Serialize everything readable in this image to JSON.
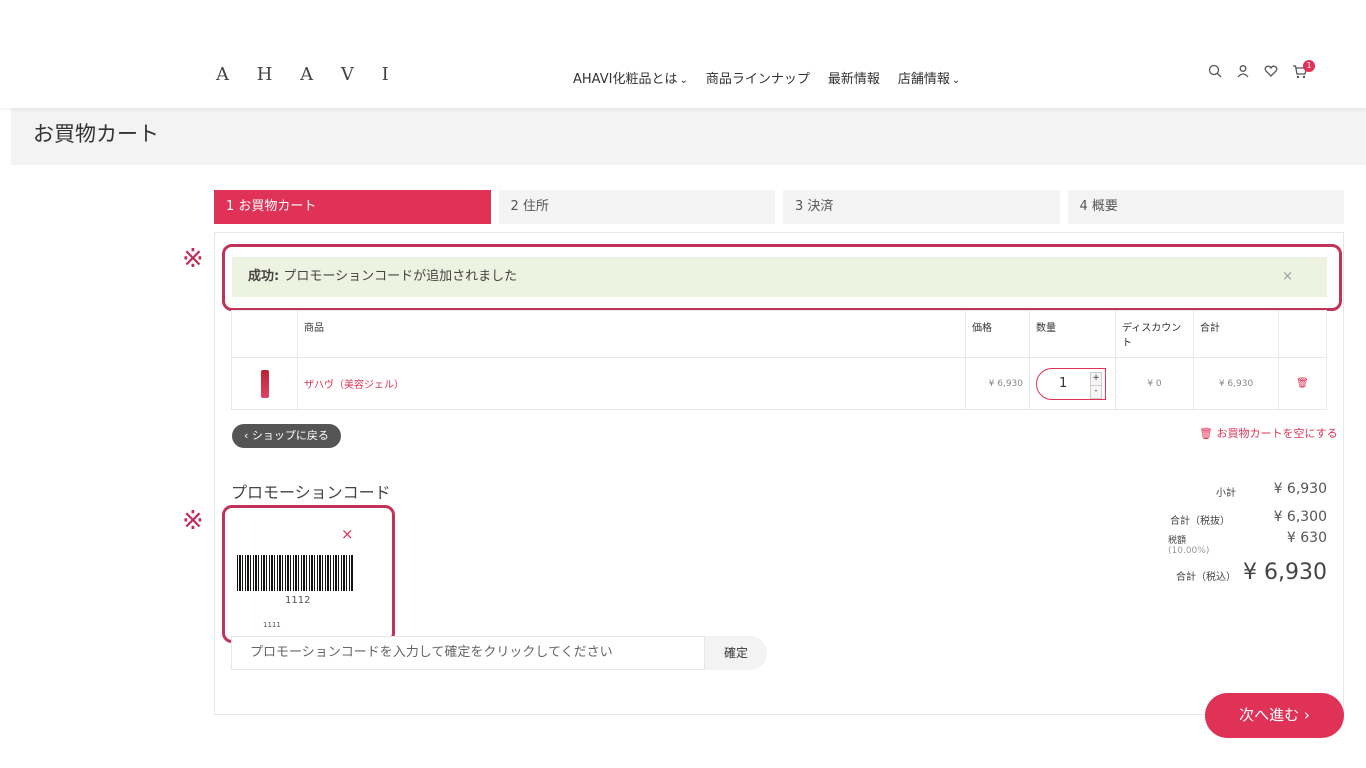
{
  "header": {
    "logo": "A H A V I",
    "nav": [
      {
        "label": "AHAVI化粧品とは",
        "has_dropdown": true
      },
      {
        "label": "商品ラインナップ",
        "has_dropdown": false
      },
      {
        "label": "最新情報",
        "has_dropdown": false
      },
      {
        "label": "店舗情報",
        "has_dropdown": true
      }
    ],
    "cart_count": "1",
    "icons": [
      "search-icon",
      "user-icon",
      "heart-icon",
      "cart-icon"
    ]
  },
  "page_title": "お買物カート",
  "steps": [
    {
      "label": "1  お買物カート",
      "active": true
    },
    {
      "label": "2  住所",
      "active": false
    },
    {
      "label": "3  決済",
      "active": false
    },
    {
      "label": "4  概要",
      "active": false
    }
  ],
  "annotation_mark": "※",
  "alert": {
    "strong": "成功:",
    "message": " プロモーションコードが追加されました",
    "close": "×"
  },
  "table": {
    "headers": [
      "",
      "商品",
      "価格",
      "数量",
      "ディスカウント",
      "合計",
      ""
    ],
    "rows": [
      {
        "product": "ザハヴ（美容ジェル）",
        "price": "¥ 6,930",
        "qty": "1",
        "discount": "¥ 0",
        "total": "¥ 6,930"
      }
    ]
  },
  "back_button": "ショップに戻る",
  "empty_cart": "お買物カートを空にする",
  "promo": {
    "title": "プロモーションコード",
    "coupon_barcode_number": "1112",
    "coupon_code": "1111",
    "remove": "×",
    "placeholder": "プロモーションコードを入力して確定をクリックしてください",
    "confirm": "確定"
  },
  "totals": {
    "subtotal_label": "小計",
    "subtotal": "¥ 6,930",
    "net_label": "合計（税抜）",
    "net": "¥ 6,300",
    "tax_label": "税額",
    "tax_rate": "(10.00%)",
    "tax": "¥ 630",
    "gross_label": "合計（税込）",
    "gross": "¥ 6,930"
  },
  "next_button": "次へ進む",
  "colors": {
    "accent": "#e03157",
    "alert_bg": "#eef2e1",
    "annotation": "#c2335a"
  }
}
